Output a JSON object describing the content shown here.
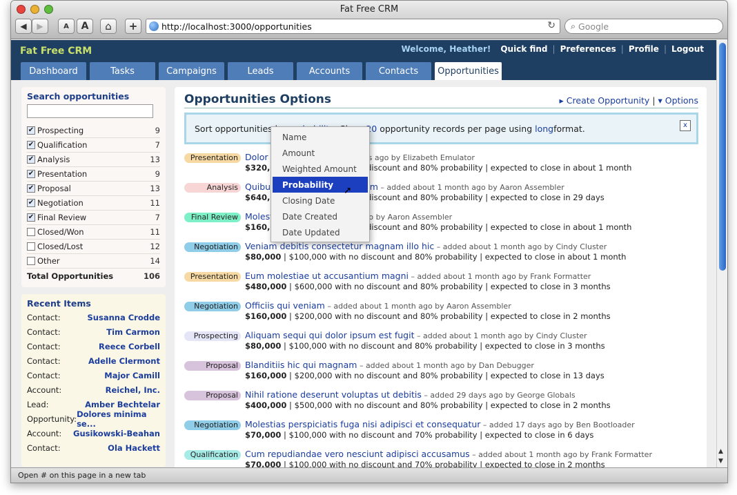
{
  "window": {
    "title": "Fat Free CRM"
  },
  "toolbar": {
    "back": "◀",
    "forward": "▶",
    "small_text": "A",
    "large_text": "A",
    "home": "⌂",
    "add": "+",
    "url": "http://localhost:3000/opportunities",
    "reload": "↻",
    "search_placeholder": "Google"
  },
  "app": {
    "logo": "Fat Free CRM"
  },
  "topnav": {
    "welcome": "Welcome, Heather!",
    "quick_find": "Quick find",
    "preferences": "Preferences",
    "profile": "Profile",
    "logout": "Logout",
    "separator": "|"
  },
  "tabs": [
    "Dashboard",
    "Tasks",
    "Campaigns",
    "Leads",
    "Accounts",
    "Contacts",
    "Opportunities"
  ],
  "search_box": {
    "title": "Search opportunities",
    "filters": [
      {
        "label": "Prospecting",
        "count": "9",
        "checked": true
      },
      {
        "label": "Qualification",
        "count": "7",
        "checked": true
      },
      {
        "label": "Analysis",
        "count": "13",
        "checked": true
      },
      {
        "label": "Presentation",
        "count": "9",
        "checked": true
      },
      {
        "label": "Proposal",
        "count": "13",
        "checked": true
      },
      {
        "label": "Negotiation",
        "count": "11",
        "checked": true
      },
      {
        "label": "Final Review",
        "count": "7",
        "checked": true
      },
      {
        "label": "Closed/Won",
        "count": "11",
        "checked": false
      },
      {
        "label": "Closed/Lost",
        "count": "12",
        "checked": false
      },
      {
        "label": "Other",
        "count": "14",
        "checked": false
      }
    ],
    "total_label": "Total Opportunities",
    "total_count": "106"
  },
  "recent": {
    "title": "Recent Items",
    "items": [
      {
        "type": "Contact:",
        "name": "Susanna Crodde"
      },
      {
        "type": "Contact:",
        "name": "Tim Carmon"
      },
      {
        "type": "Contact:",
        "name": "Reece Corbell"
      },
      {
        "type": "Contact:",
        "name": "Adelle Clermont"
      },
      {
        "type": "Contact:",
        "name": "Major Camill"
      },
      {
        "type": "Account:",
        "name": "Reichel, Inc."
      },
      {
        "type": "Lead:",
        "name": "Amber Bechtelar"
      },
      {
        "type": "Opportunity:",
        "name": "Dolores minima se..."
      },
      {
        "type": "Account:",
        "name": "Gusikowski-Beahan"
      },
      {
        "type": "Contact:",
        "name": "Ola Hackett"
      }
    ]
  },
  "main": {
    "title": "Opportunities Options",
    "create": "▸ Create Opportunity",
    "options": "▾ Options",
    "sep": "|",
    "options_bar": {
      "p1": "Sort opportunities by ",
      "sort_by": "probability",
      "p2": ". Show ",
      "per_page": "20",
      "p3": " opportunity records per page using ",
      "format": "long",
      "p4": " format.",
      "close": "x"
    }
  },
  "sort_menu": {
    "items": [
      "Name",
      "Amount",
      "Weighted Amount",
      "Probability",
      "Closing Date",
      "Date Created",
      "Date Updated"
    ],
    "selected": "Probability"
  },
  "opportunities": [
    {
      "stage": "Presentation",
      "color": "#f6d9a3",
      "name": "Dolor rat",
      "meta": " – added about 16 days ago by Elizabeth Emulator",
      "amount": "$320,000",
      "detail": " | $400,000 with no discount and 80% probability | expected to close in about 1 month"
    },
    {
      "stage": "Analysis",
      "color": "#f9d6d6",
      "name": "Quibusdam aut excepturi illum",
      "meta": " – added about 1 month ago by Aaron Assembler",
      "amount": "$640,000",
      "detail": " | $800,000 with no discount and 80% probability | expected to close in 29 days"
    },
    {
      "stage": "Final Review",
      "color": "#7ef0c8",
      "name": "Molestiae",
      "meta": " – added 2 months ago by Aaron Assembler",
      "amount": "$160,000",
      "detail": " | $200,000 with no discount and 80% probability | expected to close in about 1 month"
    },
    {
      "stage": "Negotiation",
      "color": "#8fcde8",
      "name": "Veniam debitis consectetur magnam illo hic",
      "meta": " – added about 1 month ago by Cindy Cluster",
      "amount": "$80,000",
      "detail": " | $100,000 with no discount and 80% probability | expected to close in about 1 month"
    },
    {
      "stage": "Presentation",
      "color": "#f6d9a3",
      "name": "Eum molestiae ut accusantium magni",
      "meta": " – added about 1 month ago by Frank Formatter",
      "amount": "$480,000",
      "detail": " | $600,000 with no discount and 80% probability | expected to close in 3 months"
    },
    {
      "stage": "Negotiation",
      "color": "#8fcde8",
      "name": "Officiis qui veniam",
      "meta": " – added about 1 month ago by Aaron Assembler",
      "amount": "$160,000",
      "detail": " | $200,000 with no discount and 80% probability | expected to close in 2 months"
    },
    {
      "stage": "Prospecting",
      "color": "#e4e6f8",
      "name": "Aliquam sequi qui dolor ipsum est fugit",
      "meta": " – added about 1 month ago by Cindy Cluster",
      "amount": "$80,000",
      "detail": " | $100,000 with no discount and 80% probability | expected to close in 3 months"
    },
    {
      "stage": "Proposal",
      "color": "#d8c3dd",
      "name": "Blanditiis hic qui magnam",
      "meta": " – added about 1 month ago by Dan Debugger",
      "amount": "$160,000",
      "detail": " | $200,000 with no discount and 80% probability | expected to close in 13 days"
    },
    {
      "stage": "Proposal",
      "color": "#d8c3dd",
      "name": "Nihil ratione deserunt voluptas ut debitis",
      "meta": " – added 29 days ago by George Globals",
      "amount": "$400,000",
      "detail": " | $500,000 with no discount and 80% probability | expected to close in 2 months"
    },
    {
      "stage": "Negotiation",
      "color": "#8fcde8",
      "name": "Molestias perspiciatis fuga nisi adipisci et consequatur",
      "meta": " – added 17 days ago by Ben Bootloader",
      "amount": "$70,000",
      "detail": " | $100,000 with no discount and 70% probability | expected to close in 6 days"
    },
    {
      "stage": "Qualification",
      "color": "#a6ebe6",
      "name": "Cum repudiandae vero nesciunt adipisci accusamus",
      "meta": " – added about 1 month ago by Frank Formatter",
      "amount": "$70,000",
      "detail": " | $100,000 with no discount and 70% probability | expected to close in 2 months"
    }
  ],
  "status_bar": "Open # on this page in a new tab"
}
